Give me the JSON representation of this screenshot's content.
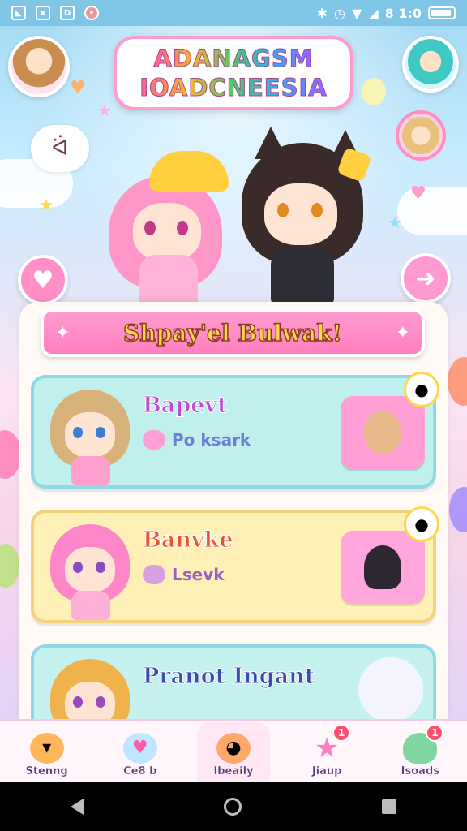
{
  "status_bar": {
    "time": "8 1:0",
    "left_icons": [
      "notification-icon",
      "image-icon",
      "document-icon",
      "app-icon"
    ],
    "right_icons": [
      "bluetooth-icon",
      "alarm-icon",
      "wifi-icon",
      "signal-icon",
      "battery-icon"
    ]
  },
  "logo": {
    "line1": "ADANAGSM",
    "line2": "IOADCNEESIA"
  },
  "banner": {
    "title": "Shpay'el Bulwak!"
  },
  "cards": [
    {
      "title": "Bapevt",
      "subtitle": "Po ksark",
      "pet": "beige-pet-icon",
      "bubble": "chat-bubble-icon"
    },
    {
      "title": "Banvke",
      "subtitle": "Lsevk",
      "pet": "dark-hair-chibi-icon",
      "bubble": "chat-bubble-icon"
    },
    {
      "title": "Pranot Ingant",
      "subtitle": "",
      "pet": "white-hair-chibi-icon",
      "bubble": ""
    }
  ],
  "bottom_nav": {
    "items": [
      {
        "label": "Stenng",
        "icon": "carrot-icon",
        "badge": ""
      },
      {
        "label": "Ce8 b",
        "icon": "heart-icon",
        "badge": ""
      },
      {
        "label": "Ibeaily",
        "icon": "cat-avatar-icon",
        "badge": ""
      },
      {
        "label": "Jiaup",
        "icon": "star-icon",
        "badge": "1"
      },
      {
        "label": "Isoads",
        "icon": "slime-icon",
        "badge": "1"
      }
    ]
  },
  "colors": {
    "accent_pink": "#ff8fc6",
    "card1_bg": "#bff0ee",
    "card2_bg": "#fff0b8",
    "banner_text": "#ffd84a"
  }
}
